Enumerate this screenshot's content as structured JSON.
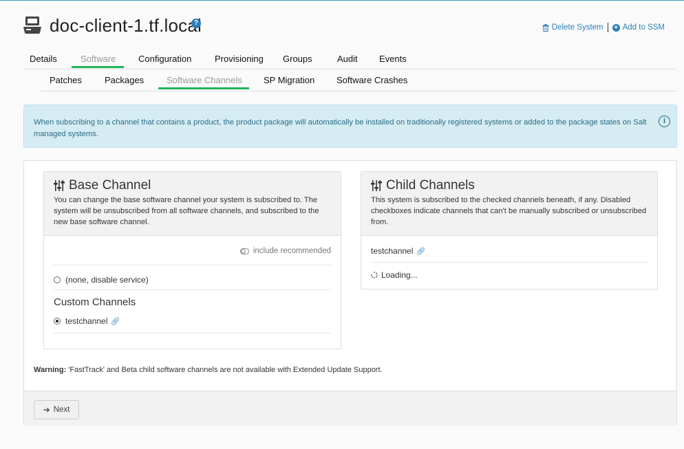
{
  "system": {
    "title": "doc-client-1.tf.local",
    "help_symbol": "?"
  },
  "header_actions": {
    "delete_label": "Delete System",
    "ssm_label": "Add to SSM"
  },
  "tabs": [
    {
      "label": "Details",
      "active": false
    },
    {
      "label": "Software",
      "active": true
    },
    {
      "label": "Configuration",
      "active": false
    },
    {
      "label": "Provisioning",
      "active": false
    },
    {
      "label": "Groups",
      "active": false
    },
    {
      "label": "Audit",
      "active": false
    },
    {
      "label": "Events",
      "active": false
    }
  ],
  "subtabs": [
    {
      "label": "Patches",
      "active": false
    },
    {
      "label": "Packages",
      "active": false
    },
    {
      "label": "Software Channels",
      "active": true
    },
    {
      "label": "SP Migration",
      "active": false
    },
    {
      "label": "Software Crashes",
      "active": false
    }
  ],
  "alert": {
    "text": "When subscribing to a channel that contains a product, the product package will automatically be installed on traditionally registered systems or added to the package states on Salt managed systems."
  },
  "base_channel": {
    "title": "Base Channel",
    "description": "You can change the base software channel your system is subscribed to. The system will be unsubscribed from all software channels, and subscribed to the new base software channel.",
    "include_recommended_label": "include recommended",
    "none_option_label": "(none, disable service)",
    "custom_heading": "Custom Channels",
    "selected_channel": "testchannel"
  },
  "child_channels": {
    "title": "Child Channels",
    "description": "This system is subscribed to the checked channels beneath, if any. Disabled checkboxes indicate channels that can't be manually subscribed or unsubscribed from.",
    "channel_name": "testchannel",
    "loading_label": "Loading..."
  },
  "warning": {
    "label": "Warning:",
    "text": " 'FastTrack' and Beta child software channels are not available with Extended Update Support."
  },
  "footer": {
    "next_label": "Next"
  },
  "colors": {
    "accent_green": "#1fb45a",
    "link_blue": "#2c7fb8",
    "alert_bg": "#d5ecf3"
  }
}
